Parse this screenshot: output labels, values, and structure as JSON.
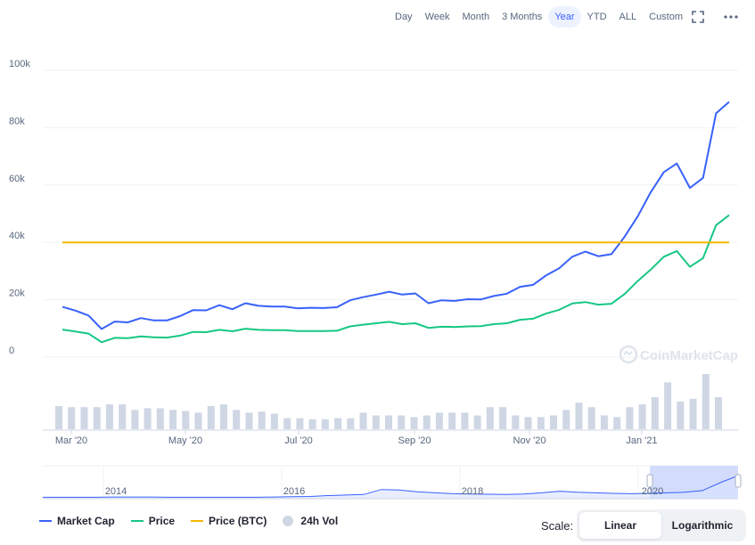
{
  "range_buttons": [
    "Day",
    "Week",
    "Month",
    "3 Months",
    "Year",
    "YTD",
    "ALL",
    "Custom"
  ],
  "active_range": "Year",
  "toolbar": {
    "expand_icon": "fullscreen-icon",
    "more_icon": "more-icon"
  },
  "watermark": "CoinMarketCap",
  "legend": {
    "market_cap": "Market Cap",
    "price": "Price",
    "price_btc": "Price (BTC)",
    "volume": "24h Vol"
  },
  "scale": {
    "label": "Scale:",
    "linear": "Linear",
    "logarithmic": "Logarithmic",
    "selected": "Linear"
  },
  "colors": {
    "market_cap": "#3861fb",
    "price": "#16c784",
    "price_btc": "#f7b500",
    "volume": "#cfd6e4",
    "accent": "#3861fb"
  },
  "chart_data": [
    {
      "type": "line",
      "x": [
        "Feb '20",
        "Mar '20",
        "Mar '20",
        "Mar '20",
        "Apr '20",
        "Apr '20",
        "Apr '20",
        "Apr '20",
        "May '20",
        "May '20",
        "May '20",
        "May '20",
        "Jun '20",
        "Jun '20",
        "Jun '20",
        "Jun '20",
        "Jul '20",
        "Jul '20",
        "Jul '20",
        "Jul '20",
        "Aug '20",
        "Aug '20",
        "Aug '20",
        "Aug '20",
        "Sep '20",
        "Sep '20",
        "Sep '20",
        "Sep '20",
        "Oct '20",
        "Oct '20",
        "Oct '20",
        "Oct '20",
        "Nov '20",
        "Nov '20",
        "Nov '20",
        "Nov '20",
        "Dec '20",
        "Dec '20",
        "Dec '20",
        "Dec '20",
        "Jan '21",
        "Jan '21",
        "Jan '21",
        "Jan '21",
        "Feb '21",
        "Feb '21",
        "Feb '21",
        "Feb '21",
        "Feb '21",
        "Feb '21",
        "Feb '21"
      ],
      "x_ticks": [
        "Mar '20",
        "May '20",
        "Jul '20",
        "Sep '20",
        "Nov '20",
        "Jan '21"
      ],
      "y_ticks": [
        "100k",
        "80k",
        "60k",
        "40k",
        "20k",
        "0"
      ],
      "ylim": [
        0,
        100000
      ],
      "series": [
        {
          "name": "Market Cap",
          "color": "#3861fb",
          "values": [
            17500,
            16200,
            14500,
            9800,
            12400,
            12100,
            13600,
            12800,
            12800,
            14300,
            16400,
            16300,
            18100,
            16700,
            18800,
            17900,
            17600,
            17600,
            17000,
            17200,
            17100,
            17400,
            19800,
            20900,
            21800,
            22800,
            21800,
            22200,
            18800,
            19800,
            19600,
            20200,
            20100,
            21300,
            22100,
            24500,
            25200,
            28500,
            31000,
            35000,
            36800,
            35200,
            35900,
            42000,
            49000,
            57500,
            64500,
            67500,
            59000,
            62500,
            85000,
            89000
          ]
        },
        {
          "name": "Price",
          "color": "#16c784",
          "values": [
            9600,
            8900,
            8200,
            5200,
            6700,
            6600,
            7200,
            6900,
            6800,
            7500,
            8800,
            8700,
            9500,
            9000,
            9900,
            9500,
            9400,
            9400,
            9100,
            9100,
            9100,
            9200,
            10700,
            11300,
            11800,
            12300,
            11500,
            11800,
            10200,
            10600,
            10500,
            10700,
            10800,
            11500,
            11800,
            13000,
            13400,
            15200,
            16500,
            18700,
            19200,
            18300,
            18600,
            22000,
            26500,
            30500,
            35000,
            37000,
            31500,
            34500,
            46000,
            49500
          ]
        },
        {
          "name": "Price (BTC)",
          "color": "#f7b500",
          "values": [
            40000,
            40000,
            40000,
            40000,
            40000,
            40000,
            40000,
            40000,
            40000,
            40000,
            40000,
            40000,
            40000,
            40000,
            40000,
            40000,
            40000,
            40000,
            40000,
            40000,
            40000,
            40000,
            40000,
            40000,
            40000,
            40000,
            40000,
            40000,
            40000,
            40000,
            40000,
            40000,
            40000,
            40000,
            40000,
            40000,
            40000,
            40000,
            40000,
            40000,
            40000,
            40000,
            40000,
            40000,
            40000,
            40000,
            40000,
            40000,
            40000,
            40000,
            40000,
            40000
          ]
        }
      ],
      "volume": {
        "name": "24h Vol",
        "color": "#cfd6e4",
        "relative_values": [
          0.42,
          0.4,
          0.4,
          0.4,
          0.45,
          0.45,
          0.35,
          0.38,
          0.38,
          0.35,
          0.33,
          0.3,
          0.42,
          0.45,
          0.35,
          0.3,
          0.32,
          0.28,
          0.2,
          0.2,
          0.18,
          0.18,
          0.2,
          0.2,
          0.3,
          0.25,
          0.25,
          0.25,
          0.22,
          0.25,
          0.3,
          0.3,
          0.3,
          0.25,
          0.4,
          0.4,
          0.25,
          0.22,
          0.22,
          0.25,
          0.35,
          0.48,
          0.4,
          0.25,
          0.22,
          0.4,
          0.45,
          0.58,
          0.85,
          0.5,
          0.55,
          1.0,
          0.58
        ]
      }
    },
    {
      "type": "area",
      "name": "navigator",
      "x_ticks": [
        "2014",
        "2016",
        "2018",
        "2020"
      ],
      "values": [
        0.02,
        0.02,
        0.02,
        0.02,
        0.03,
        0.03,
        0.03,
        0.02,
        0.02,
        0.02,
        0.02,
        0.02,
        0.02,
        0.03,
        0.04,
        0.05,
        0.08,
        0.1,
        0.12,
        0.3,
        0.28,
        0.22,
        0.18,
        0.15,
        0.14,
        0.13,
        0.12,
        0.14,
        0.18,
        0.24,
        0.2,
        0.18,
        0.16,
        0.15,
        0.16,
        0.18,
        0.2,
        0.26,
        0.55,
        0.8
      ]
    }
  ]
}
